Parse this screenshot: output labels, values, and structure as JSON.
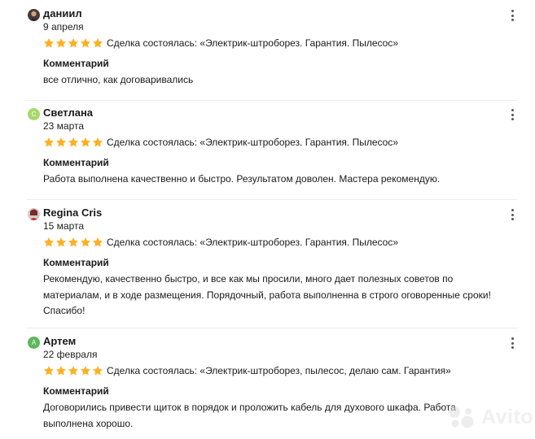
{
  "reviews": [
    {
      "author": "даниил",
      "avatar_type": "photo",
      "date": "9 апреля",
      "rating": 5,
      "deal": "Сделка состоялась: «Электрик-штроборез. Гарантия. Пылесос»",
      "comment_label": "Комментарий",
      "comment": "все отлично, как договаривались"
    },
    {
      "author": "Светлана",
      "avatar_type": "letter",
      "avatar_letter": "С",
      "avatar_color": "#a5d96a",
      "date": "23 марта",
      "rating": 5,
      "deal": "Сделка состоялась: «Электрик-штроборез. Гарантия. Пылесос»",
      "comment_label": "Комментарий",
      "comment": "Работа выполнена качественно и быстро. Результатом доволен. Мастера рекомендую."
    },
    {
      "author": "Regina Cris",
      "avatar_type": "photo",
      "date": "15 марта",
      "rating": 5,
      "deal": "Сделка состоялась: «Электрик-штроборез. Гарантия. Пылесос»",
      "comment_label": "Комментарий",
      "comment": "Рекомендую, качественно быстро, и все как мы просили, много дает полезных советов по материалам, и в ходе размещения. Порядочный, работа выполненна в строго оговоренные сроки! Спасибо!"
    },
    {
      "author": "Артем",
      "avatar_type": "letter",
      "avatar_letter": "А",
      "avatar_color": "#5cb85c",
      "date": "22 февраля",
      "rating": 5,
      "deal": "Сделка состоялась: «Электрик-штроборез, пылесос, делаю сам. Гарантия»",
      "comment_label": "Комментарий",
      "comment": "Договорились привести щиток в порядок и проложить кабель для духового шкафа. Работа выполнена хорошо."
    }
  ],
  "colors": {
    "star": "#ffb021",
    "text": "#1a1a1a"
  },
  "icons": {
    "more": "more-vertical-icon",
    "star": "star-icon"
  },
  "watermark": "Avito"
}
